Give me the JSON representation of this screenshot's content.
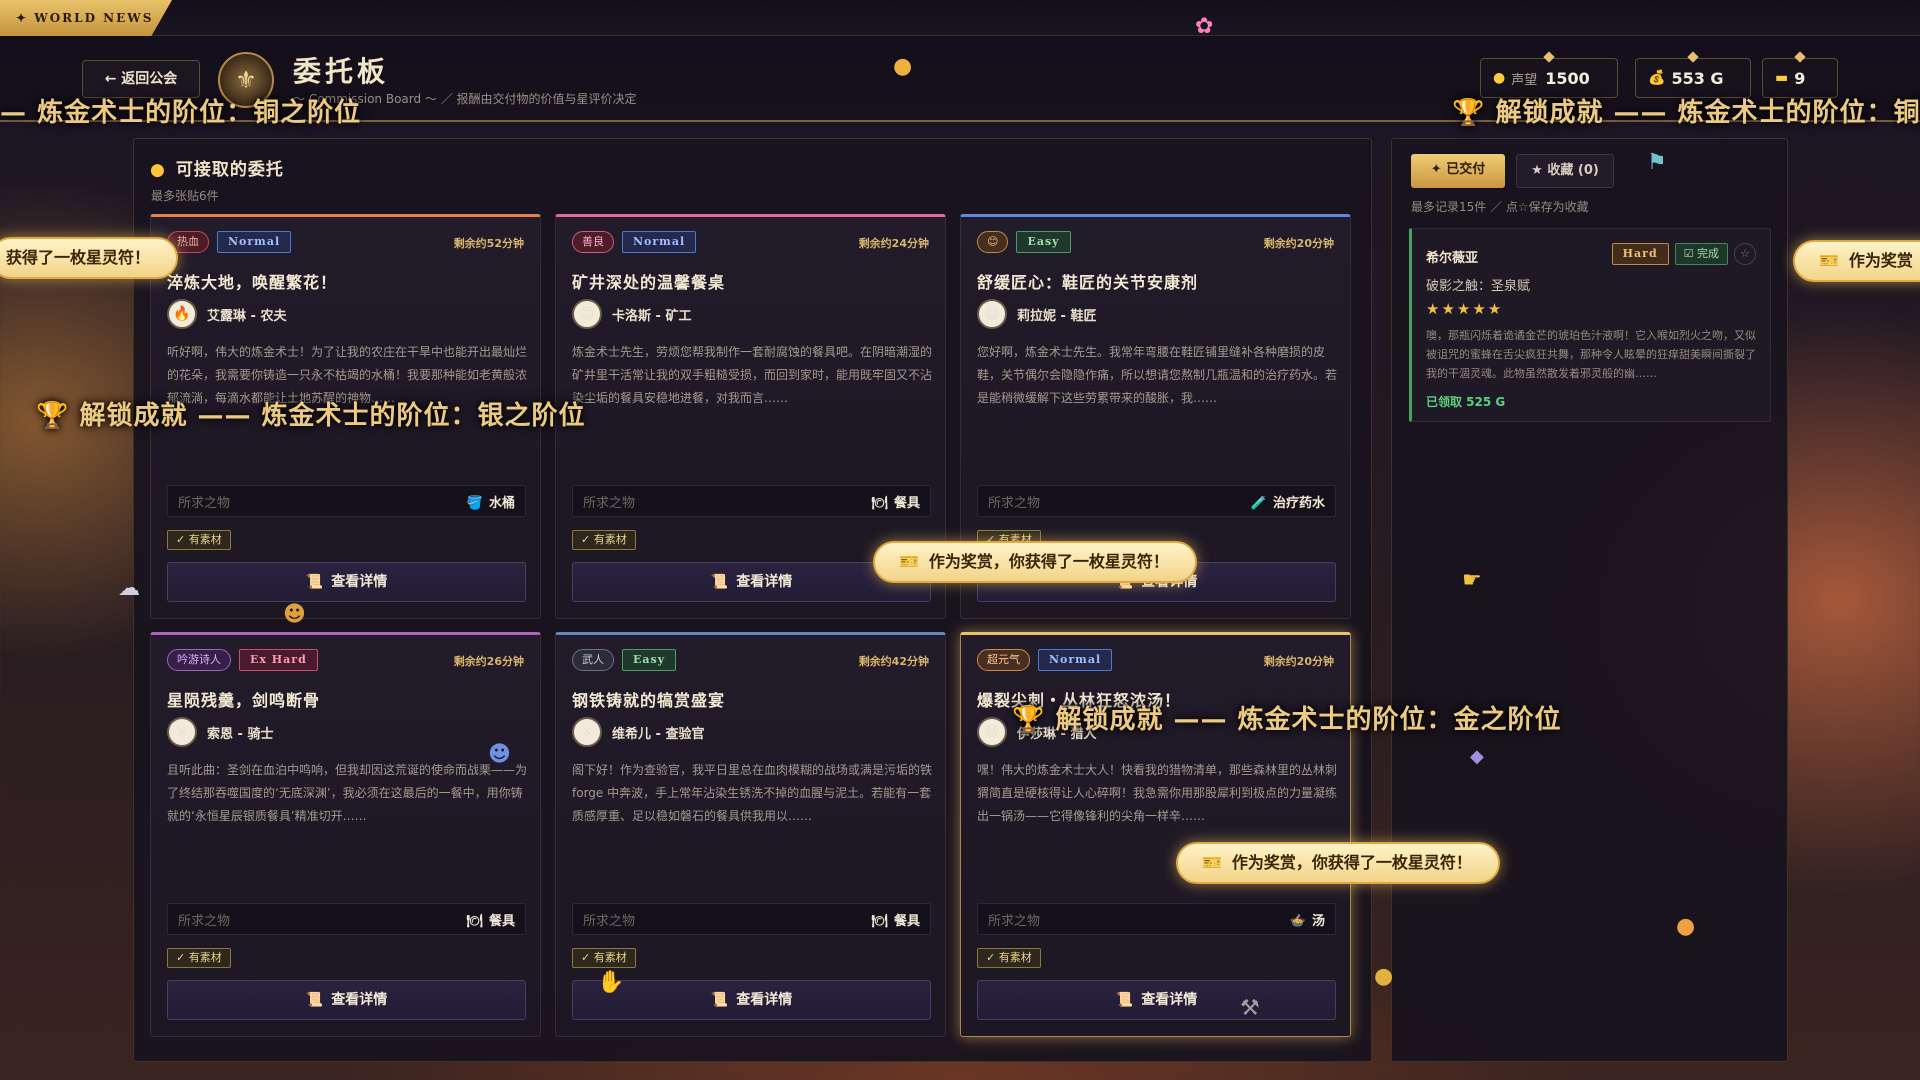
{
  "topbar": {
    "news_label": "✦ WORLD NEWS"
  },
  "header": {
    "back_label": "← 返回公会",
    "title": "委托板",
    "subtitle": "～ Commission Board ～ ／ 报酬由交付物的价值与星评价决定",
    "stats": [
      {
        "label": "声望",
        "value": "1500",
        "icon": "coin-icon"
      },
      {
        "label": "",
        "value": "553 G",
        "icon": "money-bag-icon"
      },
      {
        "label": "",
        "value": "9",
        "icon": "ticket-icon"
      }
    ]
  },
  "board": {
    "title": "可接取的委托",
    "subtitle": "最多张贴6件",
    "cards": [
      {
        "tag": "热血",
        "rank": "Normal",
        "time": "剩余约52分钟",
        "title": "淬炼大地，唤醒繁花！",
        "client": "艾露琳 - 农夫",
        "avatar": "🔥",
        "desc": "听好啊，伟大的炼金术士！为了让我的农庄在干旱中也能开出最灿烂的花朵，我需要你铸造一只永不枯竭的水桶！我要那种能如老黄般浓郁流淌，每滴水都能让土地苏醒的神物……",
        "want_label": "所求之物",
        "item_icon": "🪣",
        "item": "水桶",
        "material": "✓ 有素材",
        "detail": "查看详情"
      },
      {
        "tag": "善良",
        "rank": "Normal",
        "time": "剩余约24分钟",
        "title": "矿井深处的温馨餐桌",
        "client": "卡洛斯 - 矿工",
        "avatar": "😊",
        "desc": "炼金术士先生，劳烦您帮我制作一套耐腐蚀的餐具吧。在阴暗潮湿的矿井里干活常让我的双手粗糙受损，而回到家时，能用既牢固又不沾染尘垢的餐具安稳地进餐，对我而言……",
        "want_label": "所求之物",
        "item_icon": "🍽",
        "item": "餐具",
        "material": "✓ 有素材",
        "detail": "查看详情"
      },
      {
        "tag": "",
        "rank": "Easy",
        "time": "剩余约20分钟",
        "title": "舒缓匠心：鞋匠的关节安康剂",
        "client": "莉拉妮 - 鞋匠",
        "avatar": "😌",
        "desc": "您好啊，炼金术士先生。我常年弯腰在鞋匠铺里缝补各种磨损的皮鞋，关节偶尔会隐隐作痛，所以想请您熬制几瓶温和的治疗药水。若是能稍微缓解下这些劳累带来的酸胀，我……",
        "want_label": "所求之物",
        "item_icon": "🧪",
        "item": "治疗药水",
        "material": "✓ 有素材",
        "detail": "查看详情"
      },
      {
        "tag": "吟游诗人",
        "rank": "Ex Hard",
        "time": "剩余约26分钟",
        "title": "星陨残羹，剑鸣断骨",
        "client": "索恩 - 骑士",
        "avatar": "⚔",
        "desc": "且听此曲：圣剑在血泊中鸣响，但我却因这荒诞的使命而战栗——为了终结那吞噬国度的‘无底深渊’，我必须在这最后的一餐中，用你铸就的‘永恒星辰银质餐具’精准切开……",
        "want_label": "所求之物",
        "item_icon": "🍽",
        "item": "餐具",
        "material": "✓ 有素材",
        "detail": "查看详情"
      },
      {
        "tag": "武人",
        "rank": "Easy",
        "time": "剩余约42分钟",
        "title": "钢铁铸就的犒赏盛宴",
        "client": "维希儿 - 查验官",
        "avatar": "⚔",
        "desc": "阁下好！作为查验官，我平日里总在血肉模糊的战场或满是污垢的铁 forge 中奔波，手上常年沾染生锈洗不掉的血腥与泥土。若能有一套质感厚重、足以稳如磐石的餐具供我用以……",
        "want_label": "所求之物",
        "item_icon": "🍽",
        "item": "餐具",
        "material": "✓ 有素材",
        "detail": "查看详情"
      },
      {
        "tag": "超元气",
        "rank": "Normal",
        "time": "剩余约20分钟",
        "title": "爆裂尖刺・丛林狂怒浓汤！",
        "client": "伊莎琳 - 猎人",
        "avatar": "😆",
        "desc": "嘿！伟大的炼金术士大人！快看我的猎物清单，那些森林里的丛林刺猬简直是硬核得让人心碎啊！我急需你用那股犀利到极点的力量凝练出一锅汤——它得像锋利的尖角一样辛……",
        "want_label": "所求之物",
        "item_icon": "🍲",
        "item": "汤",
        "material": "✓ 有素材",
        "detail": "查看详情"
      }
    ]
  },
  "sidebar": {
    "tab_delivered": "已交付",
    "tab_favorites": "★ 收藏 (0)",
    "subtitle": "最多记录15件 ／ 点☆保存为收藏",
    "record": {
      "name": "希尔薇亚",
      "rank": "Hard",
      "status": "☑ 完成",
      "star_btn": "☆",
      "title": "破影之触：圣泉赋",
      "stars": "★★★★★",
      "desc": "噢，那瓶闪烁着诡谲金芒的琥珀色汁液啊！它入喉如烈火之吻，又似被诅咒的蜜蜂在舌尖疯狂共舞，那种令人眩晕的狂痒甜美瞬间撕裂了我的干涸灵魂。此物虽然散发着邪灵般的幽……",
      "reward": "已领取 525 G"
    }
  },
  "overlays": {
    "achievements": [
      "炼金术士的阶位：铜之阶位",
      "解锁成就 —— 炼金术士的阶位：铜之阶位",
      "解锁成就 —— 炼金术士的阶位：银之阶位",
      "解锁成就 —— 炼金术士的阶位：金之阶位"
    ],
    "toasts": [
      "获得了一枚星灵符！",
      "作为奖赏",
      "作为奖赏，你获得了一枚星灵符！",
      "作为奖赏，你获得了一枚星灵符！"
    ]
  },
  "colors": {
    "accent_gold": "#e9c26a",
    "normal": "#4a7ad0",
    "easy": "#4aa060",
    "ex_hard": "#d04a6a",
    "complete": "#5ad080"
  }
}
